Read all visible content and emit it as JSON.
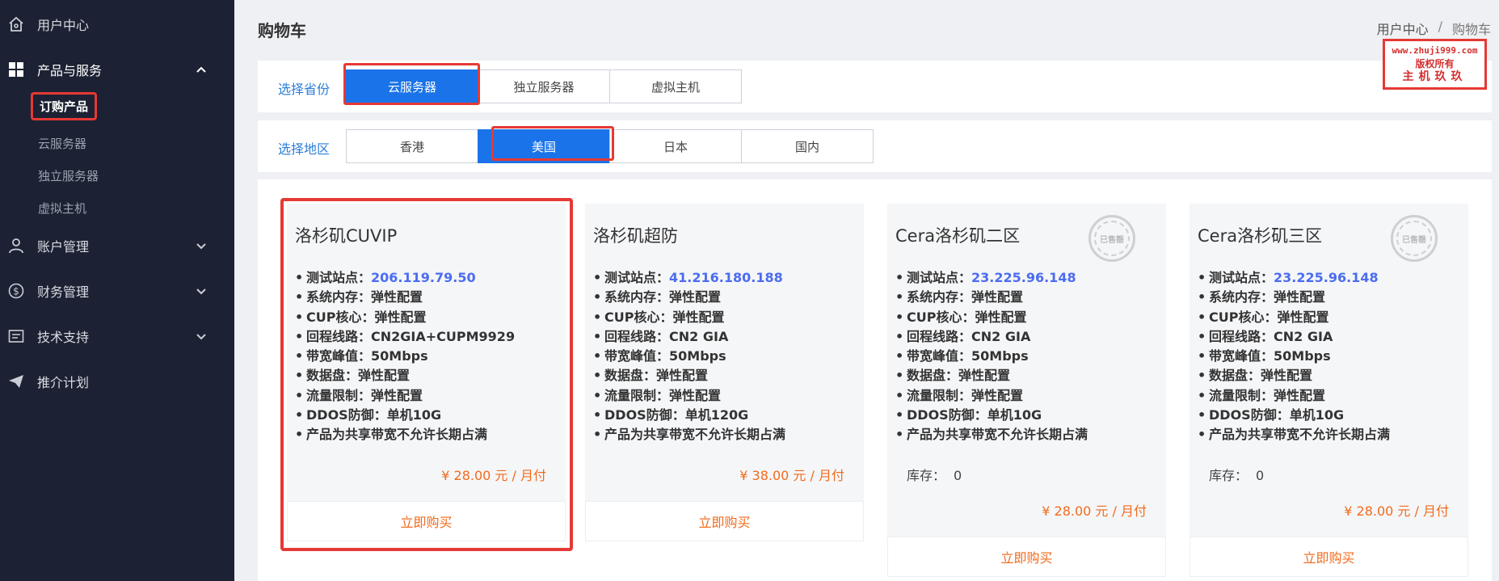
{
  "sidebar": {
    "items": [
      {
        "label": "用户中心",
        "icon": "home-icon"
      },
      {
        "label": "产品与服务",
        "icon": "grid-icon"
      },
      {
        "label": "账户管理",
        "icon": "user-icon"
      },
      {
        "label": "财务管理",
        "icon": "dollar-icon"
      },
      {
        "label": "技术支持",
        "icon": "ticket-icon"
      },
      {
        "label": "推介计划",
        "icon": "paper-plane-icon"
      }
    ],
    "subitems": [
      "订购产品",
      "云服务器",
      "独立服务器",
      "虚拟主机"
    ]
  },
  "header": {
    "title": "购物车",
    "breadcrumb": [
      "用户中心",
      "/",
      "购物车"
    ]
  },
  "watermark": {
    "line1": "www.zhuji999.com",
    "line2": "版权所有",
    "line3": "主机玖玖"
  },
  "filters": {
    "category": {
      "label": "选择省份",
      "options": [
        "云服务器",
        "独立服务器",
        "虚拟主机"
      ],
      "selected": "云服务器"
    },
    "region": {
      "label": "选择地区",
      "options": [
        "香港",
        "美国",
        "日本",
        "国内"
      ],
      "selected": "美国"
    }
  },
  "products": [
    {
      "name": "洛杉矶CUVIP",
      "specs": [
        {
          "k": "测试站点：",
          "v": "206.119.79.50"
        },
        {
          "k": "系统内存：",
          "v": "弹性配置"
        },
        {
          "k": "CUP核心：",
          "v": "弹性配置"
        },
        {
          "k": "回程线路：",
          "v": "CN2GIA+CUPM9929"
        },
        {
          "k": "带宽峰值：",
          "v": "50Mbps"
        },
        {
          "k": "数据盘：",
          "v": "弹性配置"
        },
        {
          "k": "流量限制：",
          "v": "弹性配置"
        },
        {
          "k": "DDOS防御：",
          "v": "单机10G"
        },
        {
          "k": "产品为共享带宽不允许长期占满",
          "v": ""
        }
      ],
      "price": "¥ 28.00 元 / 月付",
      "buy": "立即购买",
      "sold_out": false
    },
    {
      "name": "洛杉矶超防",
      "specs": [
        {
          "k": "测试站点：",
          "v": "41.216.180.188"
        },
        {
          "k": "系统内存：",
          "v": "弹性配置"
        },
        {
          "k": "CUP核心：",
          "v": "弹性配置"
        },
        {
          "k": "回程线路：",
          "v": "CN2 GIA"
        },
        {
          "k": "带宽峰值：",
          "v": "50Mbps"
        },
        {
          "k": "数据盘：",
          "v": "弹性配置"
        },
        {
          "k": "流量限制：",
          "v": "弹性配置"
        },
        {
          "k": "DDOS防御：",
          "v": "单机120G"
        },
        {
          "k": "产品为共享带宽不允许长期占满",
          "v": ""
        }
      ],
      "price": "¥ 38.00 元 / 月付",
      "buy": "立即购买",
      "sold_out": false
    },
    {
      "name": "Cera洛杉矶二区",
      "specs": [
        {
          "k": "测试站点：",
          "v": "23.225.96.148"
        },
        {
          "k": "系统内存：",
          "v": "弹性配置"
        },
        {
          "k": "CUP核心：",
          "v": "弹性配置"
        },
        {
          "k": "回程线路：",
          "v": "CN2 GIA"
        },
        {
          "k": "带宽峰值：",
          "v": "50Mbps"
        },
        {
          "k": "数据盘：",
          "v": "弹性配置"
        },
        {
          "k": "流量限制：",
          "v": "弹性配置"
        },
        {
          "k": "DDOS防御：",
          "v": "单机10G"
        },
        {
          "k": "产品为共享带宽不允许长期占满",
          "v": ""
        }
      ],
      "stock_label": "库存：",
      "stock": "0",
      "price": "¥ 28.00 元 / 月付",
      "buy": "立即购买",
      "sold_out": true,
      "sold_out_text": "已售罄"
    },
    {
      "name": "Cera洛杉矶三区",
      "specs": [
        {
          "k": "测试站点：",
          "v": "23.225.96.148"
        },
        {
          "k": "系统内存：",
          "v": "弹性配置"
        },
        {
          "k": "CUP核心：",
          "v": "弹性配置"
        },
        {
          "k": "回程线路：",
          "v": "CN2 GIA"
        },
        {
          "k": "带宽峰值：",
          "v": "50Mbps"
        },
        {
          "k": "数据盘：",
          "v": "弹性配置"
        },
        {
          "k": "流量限制：",
          "v": "弹性配置"
        },
        {
          "k": "DDOS防御：",
          "v": "单机10G"
        },
        {
          "k": "产品为共享带宽不允许长期占满",
          "v": ""
        }
      ],
      "stock_label": "库存：",
      "stock": "0",
      "price": "¥ 28.00 元 / 月付",
      "buy": "立即购买",
      "sold_out": true,
      "sold_out_text": "已售罄"
    }
  ],
  "colors": {
    "sidebar_bg": "#1c2233",
    "accent_blue": "#1a73e8",
    "price_orange": "#f26b1d",
    "link_blue": "#4b6cf0",
    "highlight_red": "#e53935"
  }
}
